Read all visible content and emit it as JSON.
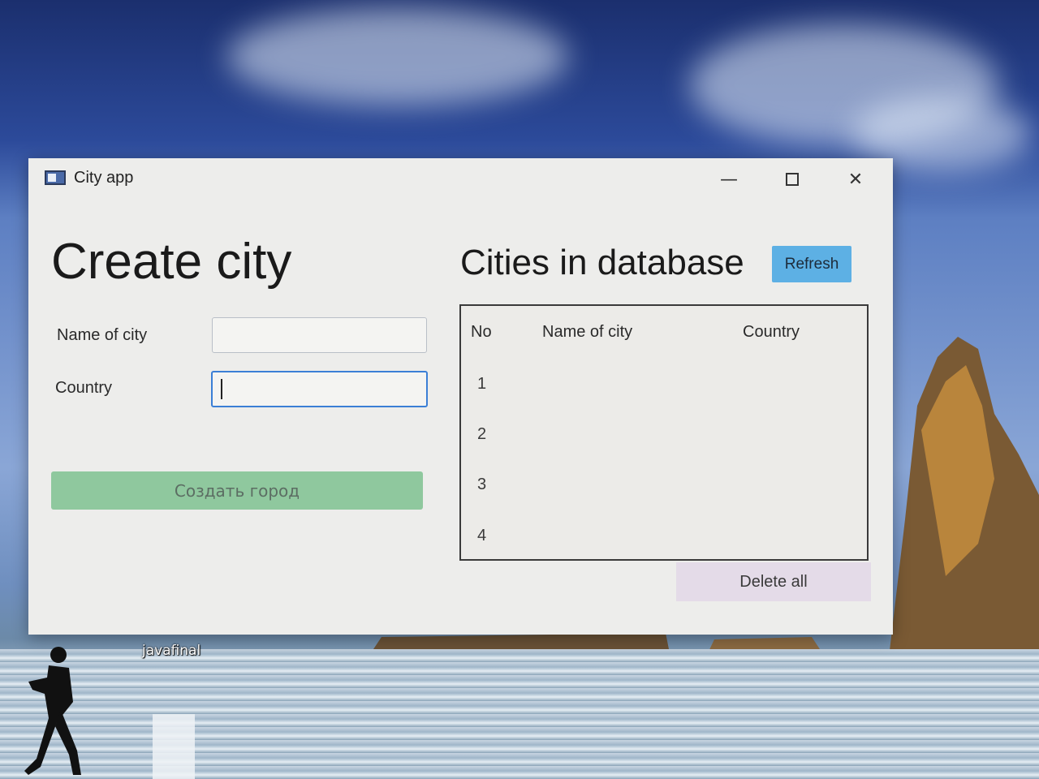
{
  "window": {
    "title": "City app",
    "controls": {
      "minimize": "—",
      "close": "✕"
    }
  },
  "create": {
    "heading": "Create city",
    "name_label": "Name of city",
    "name_value": "",
    "country_label": "Country",
    "country_value": "",
    "submit_label": "Создать город"
  },
  "database": {
    "heading": "Cities in database",
    "refresh_label": "Refresh",
    "columns": [
      "No",
      "Name of city",
      "Country"
    ],
    "rows": [
      {
        "no": "1"
      },
      {
        "no": "2"
      },
      {
        "no": "3"
      },
      {
        "no": "4"
      }
    ],
    "delete_label": "Delete all"
  },
  "desktop": {
    "icon_label": "javafinal"
  },
  "colors": {
    "create_button": "#8fc89e",
    "refresh_button": "#5db0e4",
    "delete_button": "#e4dbe8",
    "focus_border": "#3b7fd6"
  }
}
